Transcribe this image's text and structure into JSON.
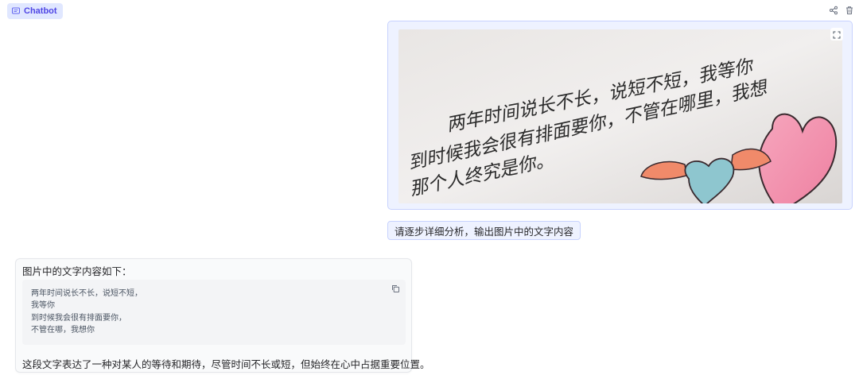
{
  "header": {
    "label": "Chatbot",
    "label_icon": "chat-icon",
    "actions": [
      {
        "name": "share",
        "icon": "share-icon"
      },
      {
        "name": "clear",
        "icon": "trash-icon"
      }
    ]
  },
  "messages": {
    "user_image": {
      "handwriting_lines": [
        "两年时间说长不长，说短不短，我等你",
        "到时候我会很有排面要你，不管在哪里，我想",
        "那个人终究是你。"
      ],
      "expand_icon": "fullscreen-icon"
    },
    "user_text": "请逐步详细分析，输出图片中的文字内容",
    "bot": {
      "intro": "图片中的文字内容如下：",
      "code_lines": [
        "两年时间说长不长，说短不短，",
        "我等你",
        "到时候我会很有排面要你，",
        "不管在哪，我想你"
      ],
      "copy_icon": "copy-icon",
      "summary": "这段文字表达了一种对某人的等待和期待，尽管时间不长或短，但始终在心中占据重要位置。"
    }
  },
  "colors": {
    "accent": "#4f46e5",
    "accent_light": "#e0e7ff",
    "user_bubble_bg": "#eef2ff",
    "user_bubble_border": "#c7d2fe",
    "bot_bubble_bg": "#f9fafb"
  }
}
